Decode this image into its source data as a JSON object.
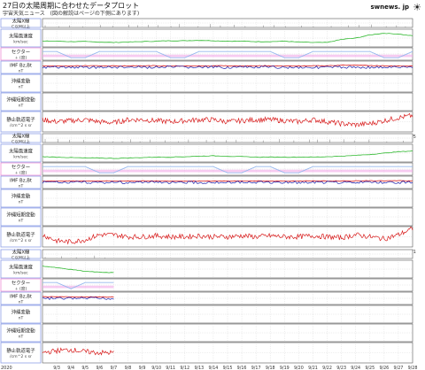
{
  "header": {
    "title": "27日の太陽周期に合わせたデータプロット",
    "subtitle_site": "宇宙天気ニュース",
    "subtitle_note": "(図の解説はページの下側にあります)",
    "logo_text": "swnews. jp"
  },
  "colors": {
    "label_blue": "#8ea0e6",
    "label_pink": "#ee8fd6",
    "wind": "#2fb82f",
    "sector": "#96b8ee",
    "sector_pink": "#f2a8e8",
    "imf_red": "#d81818",
    "imf_blue": "#1a1aa8",
    "electron_red": "#d81818",
    "grid": "#c8c8c8"
  },
  "row_labels": [
    {
      "line1": "太陽X線",
      "line2": "C以M以上"
    },
    {
      "line1": "太陽風速度",
      "line2": "km/sec"
    },
    {
      "line1": "セクター",
      "line2": "+ (度)"
    },
    {
      "line1": "IMF Bz,Bt",
      "line2": "nT"
    },
    {
      "line1": "沖縄変動",
      "line2": "nT"
    },
    {
      "line1": "沖縄短期変動",
      "line2": "nT"
    },
    {
      "line1": "静止軌道電子",
      "line2": "/cm^2 s sr"
    }
  ],
  "chart_data": [
    {
      "type": "line",
      "panel": "2020-07-10 to 2020-08-05",
      "year_label": "2020",
      "x_ticks": [
        "7/10",
        "7/11",
        "7/12",
        "7/13",
        "7/14",
        "7/15",
        "7/16",
        "7/17",
        "7/18",
        "7/19",
        "7/20",
        "7/21",
        "7/22",
        "7/23",
        "7/24",
        "7/25",
        "7/26",
        "7/27",
        "7/28",
        "7/29",
        "7/30",
        "7/31",
        "8/1",
        "8/2",
        "8/3",
        "8/4",
        "8/5"
      ],
      "tracks": {
        "solar_wind_kms": [
          380,
          380,
          370,
          370,
          360,
          350,
          360,
          370,
          380,
          390,
          390,
          400,
          390,
          380,
          380,
          370,
          370,
          380,
          360,
          350,
          350,
          420,
          450,
          520,
          560,
          540,
          500
        ],
        "sector_state": [
          1,
          1,
          0,
          0,
          1,
          1,
          1,
          1,
          1,
          0,
          0,
          1,
          1,
          1,
          1,
          1,
          1,
          0,
          0,
          1,
          1,
          1,
          1,
          1,
          0,
          0,
          1
        ],
        "imf_bt_nT": [
          5,
          5,
          5,
          6,
          5,
          5,
          6,
          6,
          5,
          5,
          5,
          5,
          6,
          5,
          5,
          6,
          5,
          5,
          5,
          6,
          7,
          8,
          7,
          6,
          5,
          5,
          5
        ],
        "electron_level": [
          0.6,
          0.5,
          0.55,
          0.6,
          0.5,
          0.45,
          0.6,
          0.6,
          0.55,
          0.5,
          0.55,
          0.6,
          0.6,
          0.5,
          0.55,
          0.6,
          0.6,
          0.55,
          0.5,
          0.6,
          0.5,
          0.4,
          0.35,
          0.4,
          0.55,
          0.7,
          0.8
        ]
      }
    },
    {
      "type": "line",
      "panel": "2020-08-06 to 2020-09-01",
      "year_label": "2020",
      "x_ticks": [
        "8/6",
        "8/7",
        "8/8",
        "8/9",
        "8/10",
        "8/11",
        "8/12",
        "8/13",
        "8/14",
        "8/15",
        "8/16",
        "8/17",
        "8/18",
        "8/19",
        "8/20",
        "8/21",
        "8/22",
        "8/23",
        "8/24",
        "8/25",
        "8/26",
        "8/27",
        "8/28",
        "8/29",
        "8/30",
        "8/31",
        "9/1"
      ],
      "tracks": {
        "solar_wind_kms": [
          370,
          360,
          350,
          340,
          340,
          330,
          340,
          350,
          360,
          360,
          370,
          380,
          390,
          380,
          370,
          360,
          360,
          360,
          360,
          360,
          370,
          380,
          400,
          420,
          450,
          480,
          500
        ],
        "sector_state": [
          1,
          1,
          1,
          1,
          0,
          0,
          1,
          1,
          1,
          1,
          1,
          1,
          1,
          0,
          0,
          1,
          1,
          0,
          0,
          1,
          1,
          1,
          1,
          1,
          1,
          1,
          1
        ],
        "imf_bt_nT": [
          5,
          5,
          5,
          5,
          5,
          5,
          5,
          5,
          5,
          5,
          5,
          5,
          5,
          5,
          5,
          5,
          5,
          5,
          5,
          5,
          5,
          5,
          6,
          6,
          6,
          6,
          6
        ],
        "electron_level": [
          0.6,
          0.3,
          0.25,
          0.35,
          0.6,
          0.6,
          0.5,
          0.5,
          0.55,
          0.5,
          0.5,
          0.55,
          0.5,
          0.5,
          0.55,
          0.5,
          0.55,
          0.5,
          0.5,
          0.55,
          0.5,
          0.45,
          0.6,
          0.5,
          0.4,
          0.6,
          0.9
        ]
      }
    },
    {
      "type": "line",
      "panel": "2020-09-02 to 2020-09-28",
      "year_label": "2020",
      "x_ticks": [
        "9/2",
        "9/3",
        "9/4",
        "9/5",
        "9/6",
        "9/7",
        "9/8",
        "9/9",
        "9/10",
        "9/11",
        "9/12",
        "9/13",
        "9/14",
        "9/15",
        "9/16",
        "9/17",
        "9/18",
        "9/19",
        "9/20",
        "9/21",
        "9/22",
        "9/23",
        "9/24",
        "9/25",
        "9/26",
        "9/27",
        "9/28"
      ],
      "tracks": {
        "solar_wind_kms": [
          520,
          480,
          440,
          400,
          380,
          370
        ],
        "sector_state": [
          1,
          1,
          0,
          1,
          1,
          1
        ],
        "imf_bt_nT": [
          6,
          6,
          5,
          5,
          5,
          5
        ],
        "electron_level": [
          0.5,
          0.6,
          0.65,
          0.55,
          0.5,
          0.5
        ]
      }
    }
  ]
}
